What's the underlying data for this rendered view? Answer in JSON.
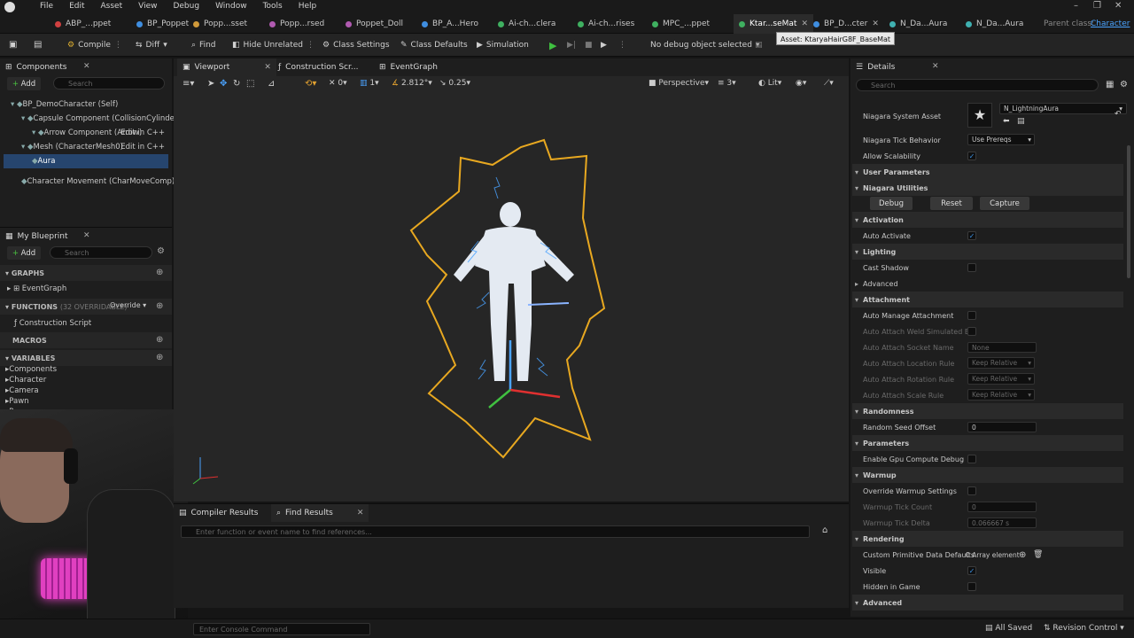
{
  "menu": {
    "items": [
      "File",
      "Edit",
      "Asset",
      "View",
      "Debug",
      "Window",
      "Tools",
      "Help"
    ]
  },
  "window_controls": {
    "minimize": "–",
    "restore": "❐",
    "close": "✕"
  },
  "tabs": [
    {
      "label": "ABP_...ppet",
      "color": "#d04040"
    },
    {
      "label": "BP_Poppet",
      "color": "#3f8ee0"
    },
    {
      "label": "Popp...sset",
      "color": "#d09a3a"
    },
    {
      "label": "Popp...rsed",
      "color": "#b05ab0"
    },
    {
      "label": "Poppet_Doll",
      "color": "#b05ab0"
    },
    {
      "label": "BP_A...Hero",
      "color": "#3f8ee0"
    },
    {
      "label": "Ai-ch...clera",
      "color": "#3fb060"
    },
    {
      "label": "Ai-ch...rises",
      "color": "#3fb060"
    },
    {
      "label": "MPC_...ppet",
      "color": "#3fb060"
    },
    {
      "label": "Ktar...seMat",
      "color": "#3fb060"
    },
    {
      "label": "BP_D...cter",
      "color": "#3f8ee0"
    },
    {
      "label": "N_Da...Aura",
      "color": "#3fb0b0"
    },
    {
      "label": "N_Da...Aura",
      "color": "#3fb0b0"
    }
  ],
  "parent_class": {
    "label": "Parent class:",
    "value": "Character"
  },
  "tooltip": "Asset: KtaryaHairG8F_BaseMat",
  "toolbar": {
    "compile": "Compile",
    "diff": "Diff",
    "find": "Find",
    "hide_unrelated": "Hide Unrelated",
    "class_settings": "Class Settings",
    "class_defaults": "Class Defaults",
    "simulation": "Simulation",
    "debug_object": "No debug object selected"
  },
  "components_panel": {
    "title": "Components",
    "add": "Add",
    "search_placeholder": "Search",
    "tree": [
      {
        "label": "BP_DemoCharacter (Self)",
        "indent": 0
      },
      {
        "label": "Capsule Component (CollisionCylinder)",
        "indent": 1
      },
      {
        "label": "Arrow Component (Arrow)",
        "indent": 2,
        "edit": "Edit in C++"
      },
      {
        "label": "Mesh (CharacterMesh0)",
        "indent": 1,
        "edit": "Edit in C++"
      },
      {
        "label": "Aura",
        "indent": 2,
        "selected": true
      },
      {
        "label": "Character Movement (CharMoveComp)",
        "indent": 1
      }
    ]
  },
  "my_blueprint": {
    "title": "My Blueprint",
    "add": "Add",
    "search_placeholder": "Search",
    "graphs": "GRAPHS",
    "event_graph": "EventGraph",
    "functions": "FUNCTIONS",
    "functions_count": "(32 OVERRIDABLE)",
    "override": "Override",
    "construction_script": "Construction Script",
    "macros": "MACROS",
    "variables": "VARIABLES",
    "variable_groups": [
      "Components",
      "Character",
      "Camera",
      "Pawn",
      "Re..."
    ]
  },
  "viewport": {
    "tabs": [
      "Viewport",
      "Construction Scr...",
      "EventGraph"
    ],
    "perspective": "Perspective",
    "lit": "Lit",
    "num_a": "0",
    "num_b": "1",
    "fov": "2.812°",
    "snap": "0.25",
    "speed": "3"
  },
  "bottom": {
    "compiler_results": "Compiler Results",
    "find_results": "Find Results",
    "find_placeholder": "Enter function or event name to find references...",
    "console_placeholder": "Enter Console Command"
  },
  "details": {
    "title": "Details",
    "search_placeholder": "Search",
    "niagara_system_label": "Niagara System Asset",
    "niagara_system_value": "N_LightningAura",
    "rows": [
      {
        "type": "prop",
        "label": "Niagara Tick Behavior",
        "dropdown": "Use Prereqs"
      },
      {
        "type": "prop",
        "label": "Allow Scalability",
        "check": true
      },
      {
        "type": "cat",
        "label": "User Parameters"
      },
      {
        "type": "cat",
        "label": "Niagara Utilities"
      },
      {
        "type": "buttons",
        "buttons": [
          "Debug",
          "Reset",
          "Capture"
        ]
      },
      {
        "type": "cat",
        "label": "Activation"
      },
      {
        "type": "prop",
        "label": "Auto Activate",
        "check": true
      },
      {
        "type": "cat",
        "label": "Lighting"
      },
      {
        "type": "prop",
        "label": "Cast Shadow",
        "check": false
      },
      {
        "type": "sub",
        "label": "Advanced"
      },
      {
        "type": "cat",
        "label": "Attachment"
      },
      {
        "type": "prop",
        "label": "Auto Manage Attachment",
        "check": false
      },
      {
        "type": "prop",
        "label": "Auto Attach Weld Simulated B...",
        "check": false,
        "dim": true
      },
      {
        "type": "prop",
        "label": "Auto Attach Socket Name",
        "value": "None",
        "dim": true
      },
      {
        "type": "prop",
        "label": "Auto Attach Location Rule",
        "dropdown": "Keep Relative",
        "dim": true
      },
      {
        "type": "prop",
        "label": "Auto Attach Rotation Rule",
        "dropdown": "Keep Relative",
        "dim": true
      },
      {
        "type": "prop",
        "label": "Auto Attach Scale Rule",
        "dropdown": "Keep Relative",
        "dim": true
      },
      {
        "type": "cat",
        "label": "Randomness"
      },
      {
        "type": "prop",
        "label": "Random Seed Offset",
        "value": "0"
      },
      {
        "type": "cat",
        "label": "Parameters"
      },
      {
        "type": "prop",
        "label": "Enable Gpu Compute Debug",
        "check": false
      },
      {
        "type": "cat",
        "label": "Warmup"
      },
      {
        "type": "prop",
        "label": "Override Warmup Settings",
        "check": false
      },
      {
        "type": "prop",
        "label": "Warmup Tick Count",
        "value": "0",
        "dim": true
      },
      {
        "type": "prop",
        "label": "Warmup Tick Delta",
        "value": "0.066667 s",
        "dim": true
      },
      {
        "type": "cat",
        "label": "Rendering"
      },
      {
        "type": "prop",
        "label": "Custom Primitive Data Defaults",
        "value": "0 Array element"
      },
      {
        "type": "prop",
        "label": "Visible",
        "check": true
      },
      {
        "type": "prop",
        "label": "Hidden in Game",
        "check": false
      },
      {
        "type": "cat",
        "label": "Advanced"
      }
    ]
  },
  "status": {
    "all_saved": "All Saved",
    "revision_control": "Revision Control"
  }
}
